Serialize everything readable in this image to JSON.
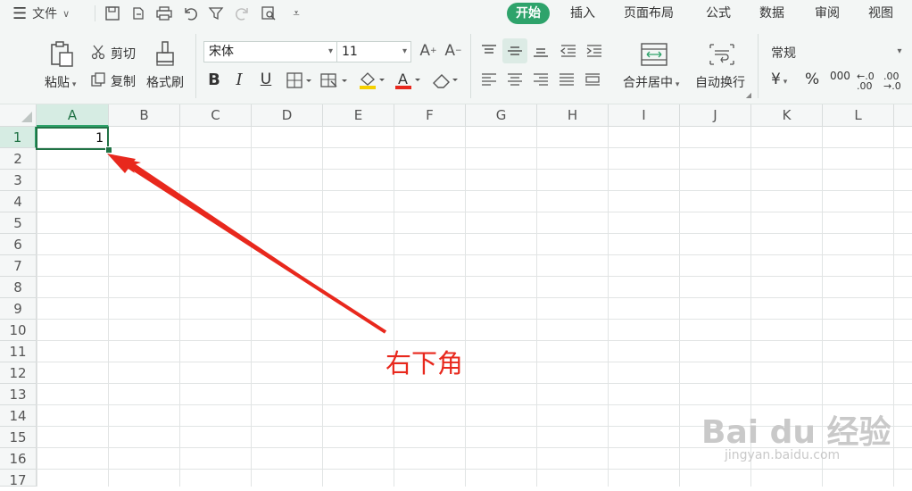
{
  "titlebar": {
    "menu_label": "文件",
    "tabs": [
      "开始",
      "插入",
      "页面布局",
      "公式",
      "数据",
      "审阅",
      "视图"
    ],
    "active_tab": "开始"
  },
  "ribbon": {
    "paste": "粘贴",
    "cut": "剪切",
    "copy": "复制",
    "format_painter": "格式刷",
    "font_name": "宋体",
    "font_size": "11",
    "merge_center": "合并居中",
    "wrap_text": "自动换行",
    "number_format": "常规",
    "currency_symbol": "¥",
    "percent_symbol": "%",
    "thousands": "000",
    "dec_increase": ".00",
    "dec_decrease": ".0"
  },
  "grid": {
    "columns": [
      "A",
      "B",
      "C",
      "D",
      "E",
      "F",
      "G",
      "H",
      "I",
      "J",
      "K",
      "L"
    ],
    "rows": [
      "1",
      "2",
      "3",
      "4",
      "5",
      "6",
      "7",
      "8",
      "9",
      "10",
      "11",
      "12",
      "13",
      "14",
      "15",
      "16",
      "17"
    ],
    "selected_cell": "A1",
    "a1_value": "1"
  },
  "annotation": {
    "text": "右下角",
    "color": "#e8281d"
  },
  "watermark": {
    "brand": "Bai du 经验",
    "url": "jingyan.baidu.com"
  },
  "colors": {
    "accent": "#2ea36b",
    "selection_border": "#217346"
  }
}
